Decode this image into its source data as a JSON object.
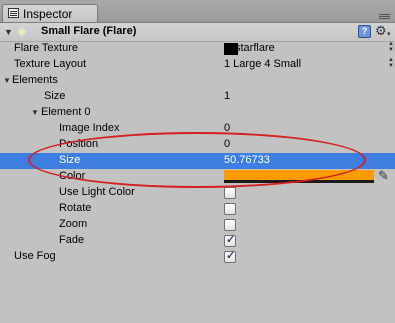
{
  "window": {
    "tab_label": "Inspector"
  },
  "component": {
    "title": "Small Flare (Flare)",
    "toggle": "▼",
    "flare_icon": "✦",
    "help_icon": "?",
    "gear_icon": "⚙",
    "caret": "▾"
  },
  "properties": {
    "flare_texture": {
      "label": "Flare Texture",
      "value": "starflare"
    },
    "texture_layout": {
      "label": "Texture Layout",
      "value": "1 Large 4 Small"
    },
    "elements": {
      "label": "Elements",
      "arrow": "▼"
    },
    "size": {
      "label": "Size",
      "value": "1"
    },
    "element0": {
      "label": "Element 0",
      "arrow": "▼"
    },
    "image_index": {
      "label": "Image Index",
      "value": "0"
    },
    "position": {
      "label": "Position",
      "value": "0"
    },
    "el_size": {
      "label": "Size",
      "value": "50.76733"
    },
    "color": {
      "label": "Color",
      "value": "#ff9a00"
    },
    "use_light_color": {
      "label": "Use Light Color",
      "checked": false
    },
    "rotate": {
      "label": "Rotate",
      "checked": false
    },
    "zoom": {
      "label": "Zoom",
      "checked": false
    },
    "fade": {
      "label": "Fade",
      "checked": true
    },
    "use_fog": {
      "label": "Use Fog",
      "checked": true
    }
  },
  "glyphs": {
    "check": "✓",
    "picker": "✎",
    "dd_up": "▲",
    "dd_down": "▼"
  },
  "colors": {
    "selection": "#3d7ee0",
    "panel": "#c2c2c2",
    "highlight_ellipse": "#d42020"
  }
}
